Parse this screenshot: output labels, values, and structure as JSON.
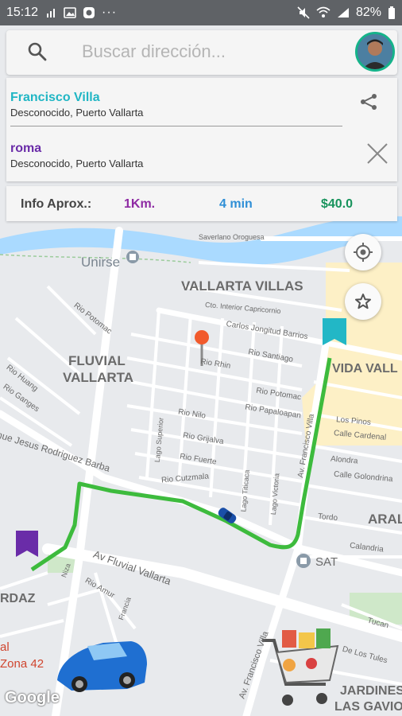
{
  "status_bar": {
    "time": "15:12",
    "battery_text": "82%",
    "icons": [
      "signal-icon",
      "image-icon",
      "app-icon",
      "more-icon",
      "mute-icon",
      "wifi-icon",
      "cell-signal-icon",
      "battery-icon"
    ]
  },
  "search": {
    "placeholder": "Buscar dirección..."
  },
  "route": {
    "origin_name": "Francisco Villa",
    "origin_detail": "Desconocido, Puerto Vallarta",
    "destination_name": "roma",
    "destination_detail": "Desconocido, Puerto Vallarta"
  },
  "info": {
    "label": "Info Aprox.:",
    "distance": "1Km.",
    "time": "4 min",
    "price": "$40.0"
  },
  "colors": {
    "origin": "#20b6c4",
    "destination": "#6a2ca8",
    "distance": "#8e2aa3",
    "time": "#2f8fd6",
    "price": "#17935c",
    "route_line": "#3dbb3d",
    "river": "#aadaff"
  },
  "map": {
    "areas": [
      "Unirse",
      "VALLARTA VILLAS",
      "FLUVIAL",
      "VALLARTA",
      "VIDA VALL",
      "ARAL",
      "SAT",
      "RDAZ",
      "JARDINES",
      "LAS GAVIO",
      "al",
      "Zona 42"
    ],
    "streets": [
      "Saverlano Oroguesa",
      "Cto. Interior Capricornio",
      "Carlos Jongitud Barrios",
      "Rio Santiago",
      "Rio Rhin",
      "Rio Potomac",
      "Rio Huang",
      "Rio Ganges",
      "Rio Potomac",
      "Rio Papaloapan",
      "Rio Nilo",
      "Rio Grijalva",
      "Rio Fuerte",
      "Rio Cutzmala",
      "Lago Superior",
      "Lago Titicaca",
      "Lago Victoria",
      "Av. Francisco Villa",
      "Los Pinos",
      "Calle Cardenal",
      "Alondra",
      "Calle Golondrina",
      "Tordo",
      "Calandria",
      "Av Fluvial Vallarta",
      "Rio Amur",
      "Francia",
      "Tucan",
      "De Los Tules",
      "Av. Francisco Villa",
      "mue Jesus Rodriguez Barba",
      "Niza"
    ]
  },
  "attribution": "Google"
}
